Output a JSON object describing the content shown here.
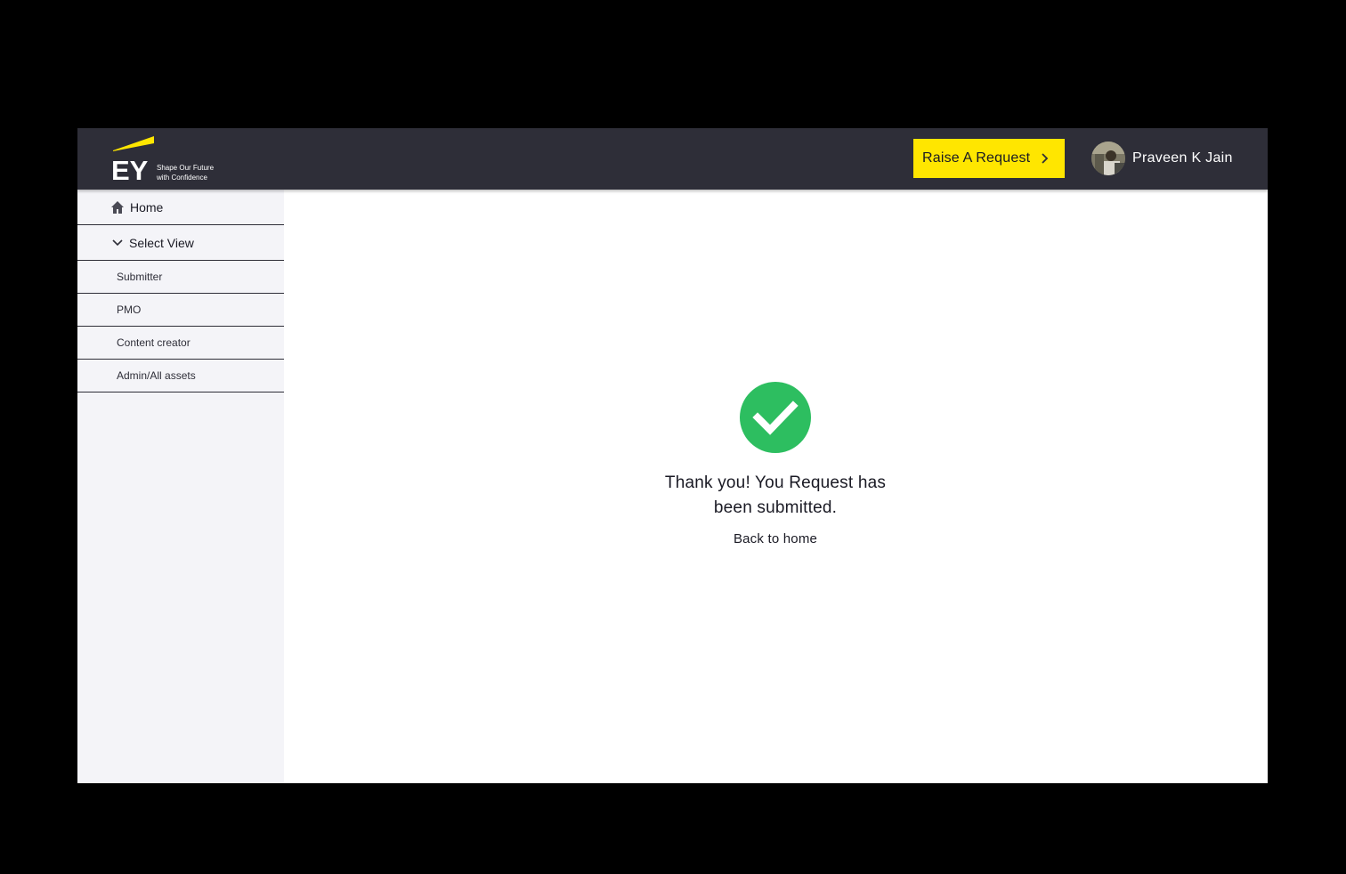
{
  "header": {
    "logo_text": "EY",
    "tagline_line1": "Shape Our Future",
    "tagline_line2": "with Confidence",
    "raise_request_label": "Raise A Request",
    "user_name": "Praveen K Jain"
  },
  "sidebar": {
    "home_label": "Home",
    "select_view_label": "Select View",
    "items": [
      {
        "label": "Submitter"
      },
      {
        "label": "PMO"
      },
      {
        "label": "Content creator"
      },
      {
        "label": "Admin/All assets"
      }
    ]
  },
  "main": {
    "message_line1": "Thank you! You Request has",
    "message_line2": "been submitted.",
    "back_link": "Back to home"
  },
  "colors": {
    "header_bg": "#2e2e38",
    "accent_yellow": "#ffe600",
    "success_green": "#2dbe60",
    "sidebar_bg": "#f4f4f8"
  },
  "icons": [
    "ey-logo",
    "chevron-right-icon",
    "home-icon",
    "chevron-down-icon",
    "success-check-icon"
  ]
}
